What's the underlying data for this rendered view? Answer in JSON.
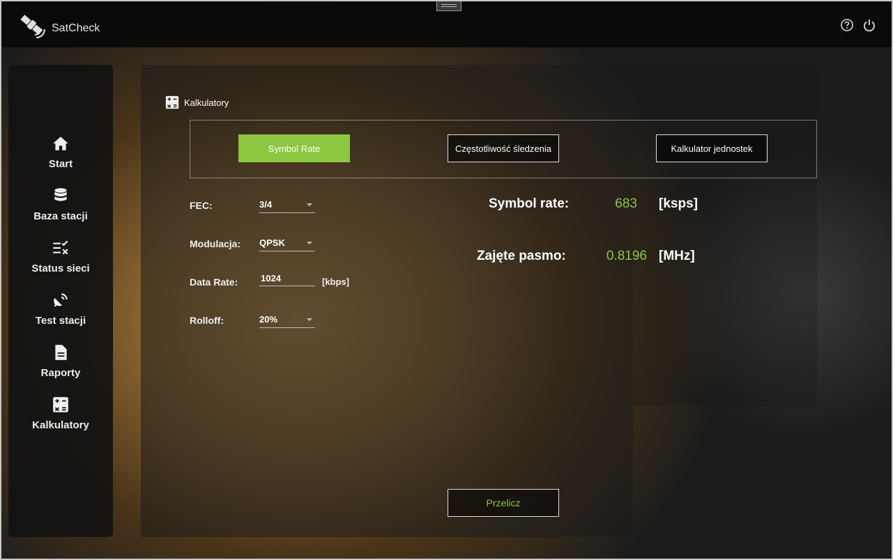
{
  "app": {
    "title": "SatCheck"
  },
  "topbar": {
    "help_icon": "help-circle-icon",
    "power_icon": "power-icon"
  },
  "sidebar": {
    "items": [
      {
        "label": "Start",
        "icon": "home-icon"
      },
      {
        "label": "Baza stacji",
        "icon": "database-icon"
      },
      {
        "label": "Status sieci",
        "icon": "checklist-icon"
      },
      {
        "label": "Test stacji",
        "icon": "satellite-dish-icon"
      },
      {
        "label": "Raporty",
        "icon": "document-icon"
      },
      {
        "label": "Kalkulatory",
        "icon": "calculator-icon"
      }
    ]
  },
  "page": {
    "title": "Kalkulatory"
  },
  "tabs": [
    {
      "label": "Symbol Rate",
      "active": true
    },
    {
      "label": "Częstotliwość śledzenia",
      "active": false
    },
    {
      "label": "Kalkulator jednostek",
      "active": false
    }
  ],
  "form": {
    "fec_label": "FEC:",
    "fec_value": "3/4",
    "modulation_label": "Modulacja:",
    "modulation_value": "QPSK",
    "datarate_label": "Data Rate:",
    "datarate_value": "1024",
    "datarate_unit": "[kbps]",
    "rolloff_label": "Rolloff:",
    "rolloff_value": "20%"
  },
  "results": {
    "symbol_rate_label": "Symbol rate:",
    "symbol_rate_value": "683",
    "symbol_rate_unit": "[ksps]",
    "bandwidth_label": "Zajęte pasmo:",
    "bandwidth_value": "0.8196",
    "bandwidth_unit": "[MHz]"
  },
  "actions": {
    "calculate_label": "Przelicz"
  },
  "colors": {
    "accent": "#8dc63f",
    "topbar": "#080808",
    "sidebar": "#121212"
  }
}
